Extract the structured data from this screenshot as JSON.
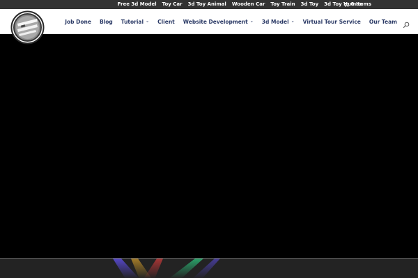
{
  "topbar": {
    "links": [
      "Free 3d Model",
      "Toy Car",
      "3d Toy Animal",
      "Wooden Car",
      "Toy Train",
      "3d Toy",
      "3d Toy Human"
    ],
    "cart_label": "0 Items",
    "background": "#333333"
  },
  "header": {
    "logo_icon": "site-logo",
    "nav": [
      {
        "label": "Job Done",
        "dropdown": false
      },
      {
        "label": "Blog",
        "dropdown": false
      },
      {
        "label": "Tutorial",
        "dropdown": true
      },
      {
        "label": "Client",
        "dropdown": false
      },
      {
        "label": "Website Development",
        "dropdown": true
      },
      {
        "label": "3d Model",
        "dropdown": true
      },
      {
        "label": "Virtual Tour Service",
        "dropdown": false
      },
      {
        "label": "Our Team",
        "dropdown": false
      }
    ],
    "search_icon": "search-icon",
    "nav_color": "#2b3a66"
  },
  "hero": {
    "background": "#000000"
  },
  "footer_band": {
    "background": "#232323"
  }
}
